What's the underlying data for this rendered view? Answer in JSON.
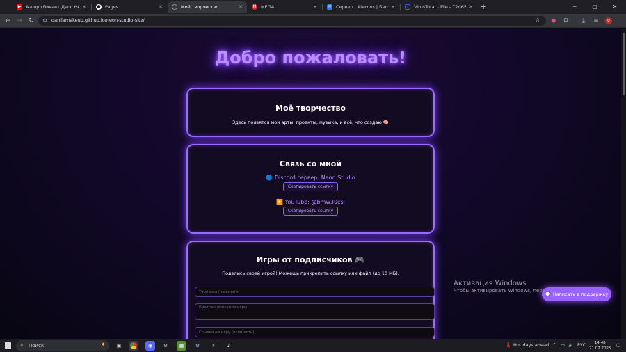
{
  "tabs": [
    {
      "title": "Азгор сбивает Десс НА РУССКОМ",
      "icon": "youtube-icon",
      "color": "#ff0000"
    },
    {
      "title": "Pages",
      "icon": "github-icon",
      "color": "#ffffff"
    },
    {
      "title": "Моё творчество",
      "icon": "globe-icon",
      "color": "#8a8a90"
    },
    {
      "title": "MEGA",
      "icon": "mega-icon",
      "color": "#d9272e"
    },
    {
      "title": "Сервер | Aternos | Бесплатный",
      "icon": "aternos-icon",
      "color": "#2c7be5"
    },
    {
      "title": "VirusTotal - File - 72d65f7099",
      "icon": "virustotal-icon",
      "color": "#3a5bd9"
    }
  ],
  "toolbar": {
    "url": "danilamakeup.github.io/neon-studio-site/",
    "ext_badge": "0"
  },
  "page": {
    "welcome": "Добро пожаловать!",
    "creativity": {
      "title": "Моё творчество",
      "text": "Здесь появятся мои арты, проекты, музыка, и всё, что создаю 🧠"
    },
    "contact": {
      "title": "Связь со мной",
      "discord": "🔵 Discord сервер: Neon Studio",
      "discord_copy": "Скопировать ссылку",
      "youtube": "▶️ YouTube: @bmw30csl",
      "youtube_copy": "Скопировать ссылку"
    },
    "games": {
      "title": "Игры от подписчиков 🎮",
      "text": "Поделись своей игрой! Можешь прикрепить ссылку или файл (до 10 МБ).",
      "name_placeholder": "Твоё имя / никнейм",
      "desc_placeholder": "Краткое описание игры",
      "link_placeholder": "Ссылка на игру (если есть)"
    },
    "support_button": "Написать в поддержку"
  },
  "activation": {
    "line1": "Активация Windows",
    "line2": "Чтобы активировать Windows, перейдите"
  },
  "taskbar": {
    "search": "Поиск",
    "weather": "Hot days ahead",
    "lang": "РУС",
    "time": "14:48",
    "date": "21.07.2025"
  },
  "colors": {
    "accent": "#9a6cff",
    "glow": "#7d3cff",
    "bg": "#12082a"
  }
}
